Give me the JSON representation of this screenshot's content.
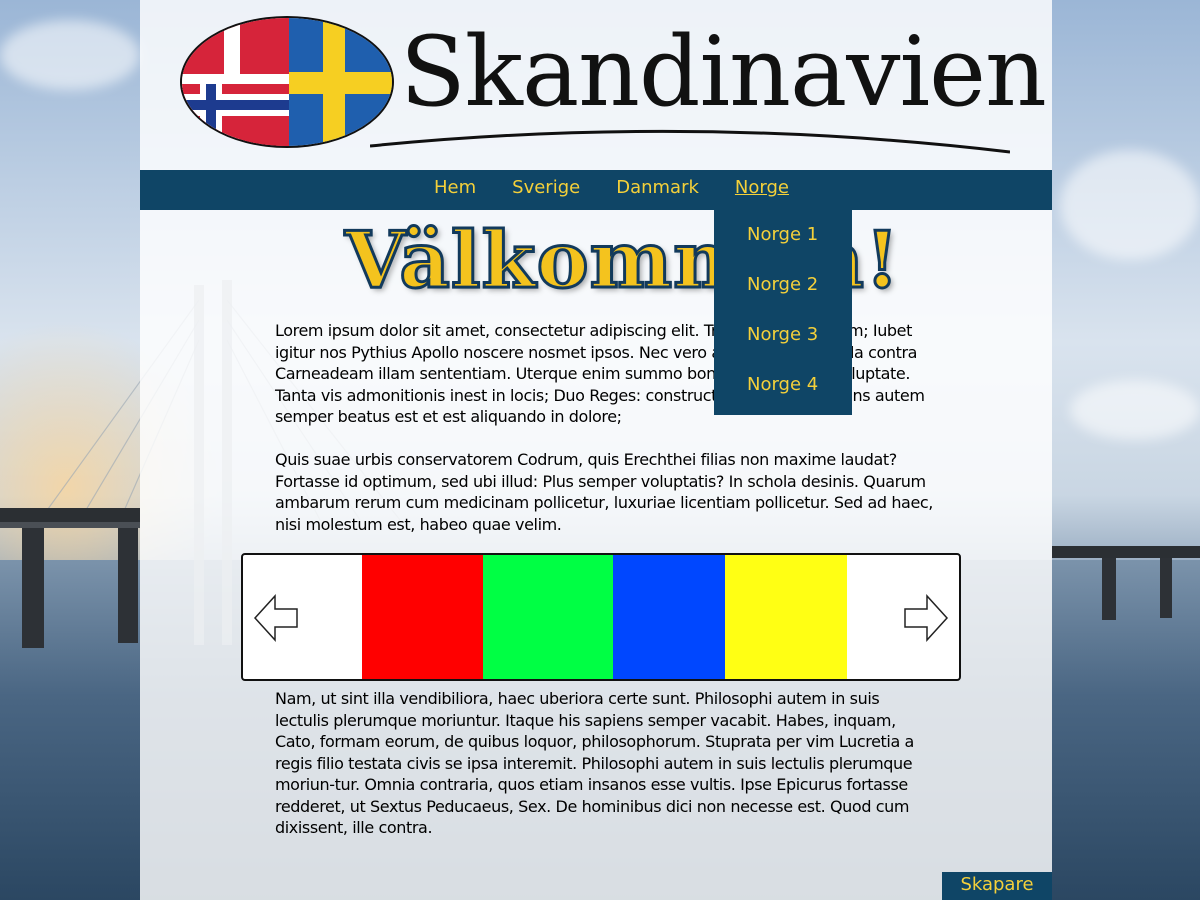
{
  "site": {
    "logo_text": "Skandinavien"
  },
  "nav": {
    "items": [
      {
        "label": "Hem"
      },
      {
        "label": "Sverige"
      },
      {
        "label": "Danmark"
      },
      {
        "label": "Norge",
        "active": true
      }
    ],
    "dropdown": [
      {
        "label": "Norge 1"
      },
      {
        "label": "Norge 2"
      },
      {
        "label": "Norge 3"
      },
      {
        "label": "Norge 4"
      }
    ]
  },
  "main": {
    "heading": "Välkommen!",
    "paragraph1": "Lorem ipsum dolor sit amet, consectetur adipiscing elit. Tria genera bonorum; Iubet igitur nos Pythius Apollo noscere nosmet ipsos. Nec vero alia sunt quaerenda contra Carneadeam illam sententiam. Uterque enim summo bono fruitur, id est voluptate. Tanta vis admonitionis inest in locis; Duo Reges: constructio interrete. Sapiens autem semper beatus est et est aliquando in dolore;",
    "paragraph2": "Quis suae urbis conservatorem Codrum, quis Erechthei filias non maxime laudat? Fortasse id optimum, sed ubi illud: Plus semper voluptatis? In schola desinis. Quarum ambarum rerum cum medicinam pollicetur, luxuriae licentiam pollicetur. Sed ad haec, nisi molestum est, habeo quae velim.",
    "paragraph3": "Nam, ut sint illa vendibiliora, haec uberiora certe sunt. Philosophi autem in suis lectulis plerumque moriuntur. Itaque his sapiens semper vacabit. Habes, inquam, Cato, formam eorum, de quibus loquor, philosophorum. Stuprata per vim Lucretia a regis filio testata civis se ipsa interemit. Philosophi autem in suis lectulis plerumque moriun-tur. Omnia contraria, quos etiam insanos esse vultis. Ipse Epicurus fortasse redderet, ut Sextus Peducaeus, Sex. De hominibus dici non necesse est. Quod cum dixissent, ille contra."
  },
  "carousel": {
    "slides": [
      {
        "color": "#ff0000"
      },
      {
        "color": "#00ff44"
      },
      {
        "color": "#0047ff"
      },
      {
        "color": "#ffff14"
      }
    ],
    "prev_icon": "arrow-left-icon",
    "next_icon": "arrow-right-icon"
  },
  "footer": {
    "link_label": "Skapare"
  },
  "colors": {
    "nav_bg": "#0f4566",
    "nav_text": "#f4d03a",
    "heading_fill": "#f4c31e",
    "heading_outline": "#123a5c"
  }
}
